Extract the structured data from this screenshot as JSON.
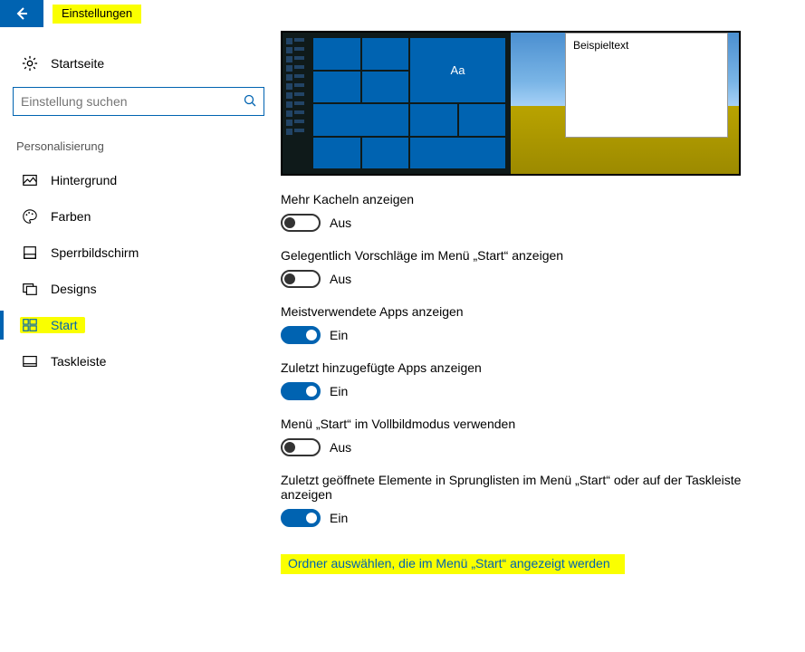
{
  "header": {
    "title": "Einstellungen"
  },
  "sidebar": {
    "home": "Startseite",
    "search_placeholder": "Einstellung suchen",
    "section": "Personalisierung",
    "items": [
      {
        "id": "hintergrund",
        "label": "Hintergrund"
      },
      {
        "id": "farben",
        "label": "Farben"
      },
      {
        "id": "sperrbildschirm",
        "label": "Sperrbildschirm"
      },
      {
        "id": "designs",
        "label": "Designs"
      },
      {
        "id": "start",
        "label": "Start"
      },
      {
        "id": "taskleiste",
        "label": "Taskleiste"
      }
    ]
  },
  "preview": {
    "tile_letter": "Aa",
    "sample_text": "Beispieltext"
  },
  "toggles": {
    "state_on": "Ein",
    "state_off": "Aus",
    "more_tiles": {
      "label": "Mehr Kacheln anzeigen",
      "on": false
    },
    "suggestions": {
      "label": "Gelegentlich Vorschläge im Menü „Start“ anzeigen",
      "on": false
    },
    "most_used": {
      "label": "Meistverwendete Apps anzeigen",
      "on": true
    },
    "recently_added": {
      "label": "Zuletzt hinzugefügte Apps anzeigen",
      "on": true
    },
    "fullscreen": {
      "label": "Menü „Start“ im Vollbildmodus verwenden",
      "on": false
    },
    "jumplist": {
      "label": "Zuletzt geöffnete Elemente in Sprunglisten im Menü „Start“ oder auf der Taskleiste anzeigen",
      "on": true
    }
  },
  "link": {
    "choose_folders": "Ordner auswählen, die im Menü „Start“ angezeigt werden"
  }
}
